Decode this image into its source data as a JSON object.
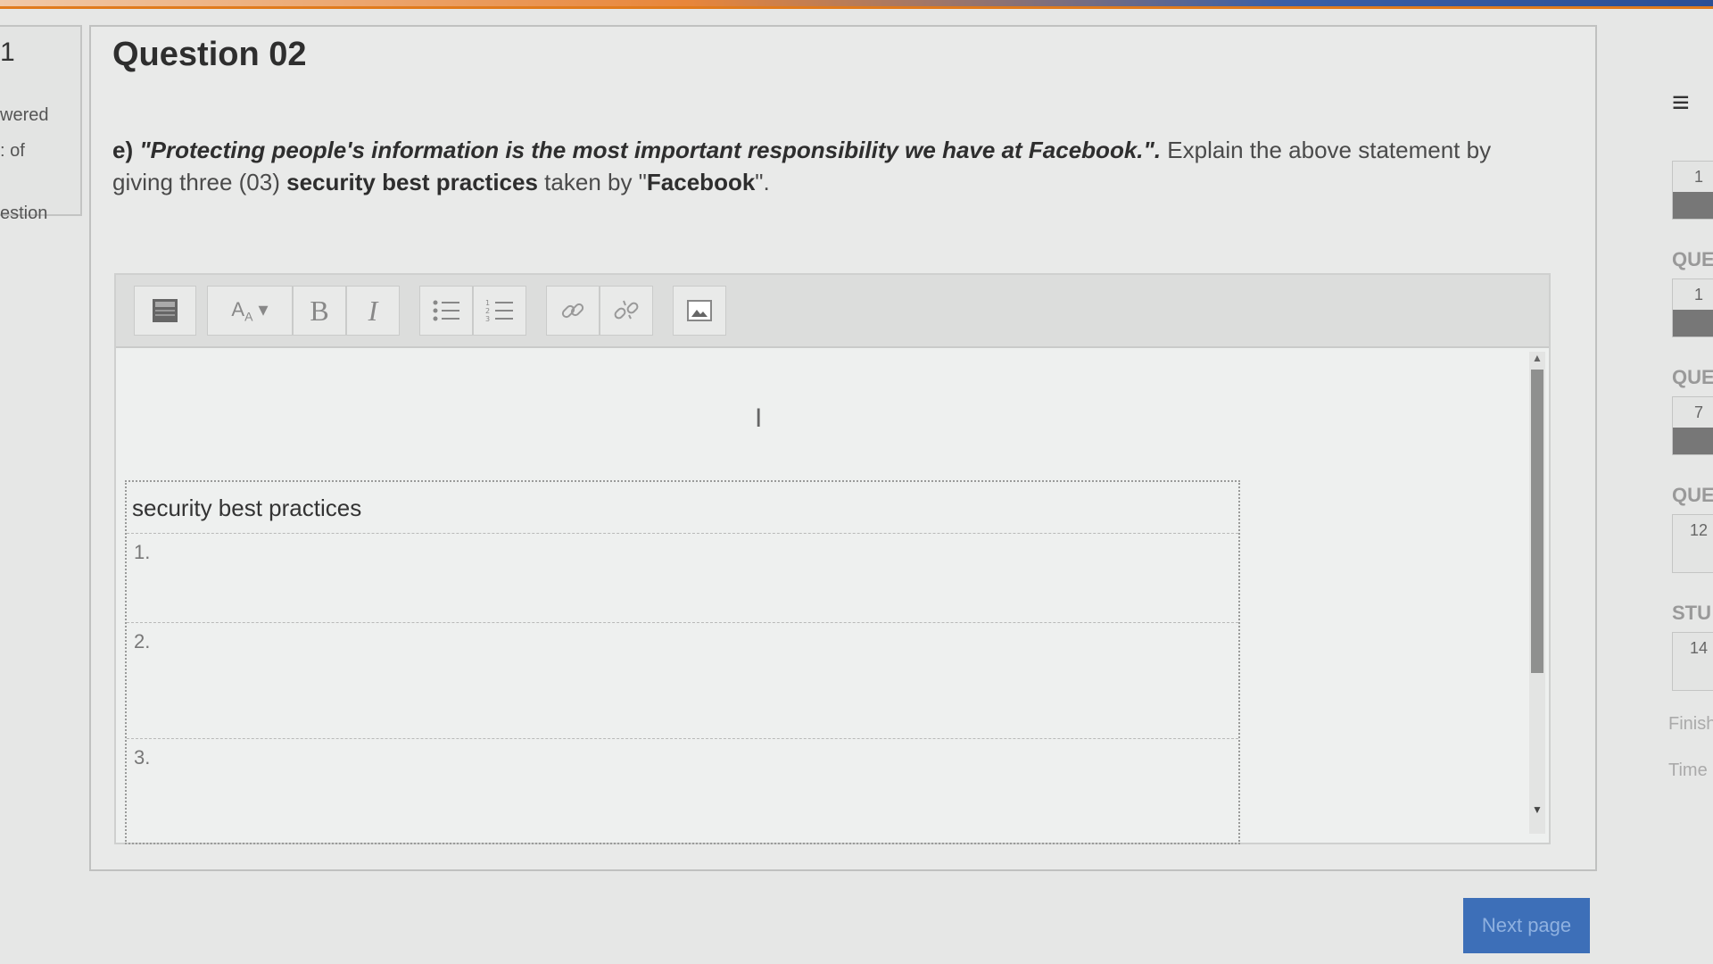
{
  "left_panel": {
    "question_number": "1",
    "status_text": "wered",
    "marked_text": ": of",
    "question_label": "estion"
  },
  "question": {
    "title": "Question 02",
    "prefix": "e)",
    "quote": "\"Protecting people's information is the most important responsibility we have at Facebook.\".",
    "instruction_part1": "Explain the above statement by giving three (03)",
    "highlight": "security best practices",
    "instruction_part2": "taken by \"",
    "company": "Facebook",
    "instruction_end": "\"."
  },
  "editor": {
    "toolbar_icons": [
      "toggle-toolbar-icon",
      "font-size-icon",
      "bold-icon",
      "italic-icon",
      "bullet-list-icon",
      "numbered-list-icon",
      "link-icon",
      "unlink-icon",
      "image-icon"
    ],
    "bold_label": "B",
    "italic_label": "I",
    "cursor_glyph": "I",
    "table": {
      "header": "security best practices",
      "rows": [
        "1.",
        "2.",
        "3."
      ]
    }
  },
  "navigation": {
    "menu_glyph": "≡",
    "tiles": [
      {
        "number": "1",
        "label": "QUE"
      },
      {
        "number": "7",
        "label": "QUE"
      },
      {
        "number": "12",
        "label": "QUE"
      },
      {
        "number": "14",
        "label": "STU"
      }
    ],
    "first_tile": "1",
    "finish_text": "Finish",
    "time_text": "Time"
  },
  "next_button": "Next page",
  "colors": {
    "accent_orange": "#e07b1d",
    "header_blue": "#2b4f95",
    "button_blue": "#3d6fb8"
  }
}
